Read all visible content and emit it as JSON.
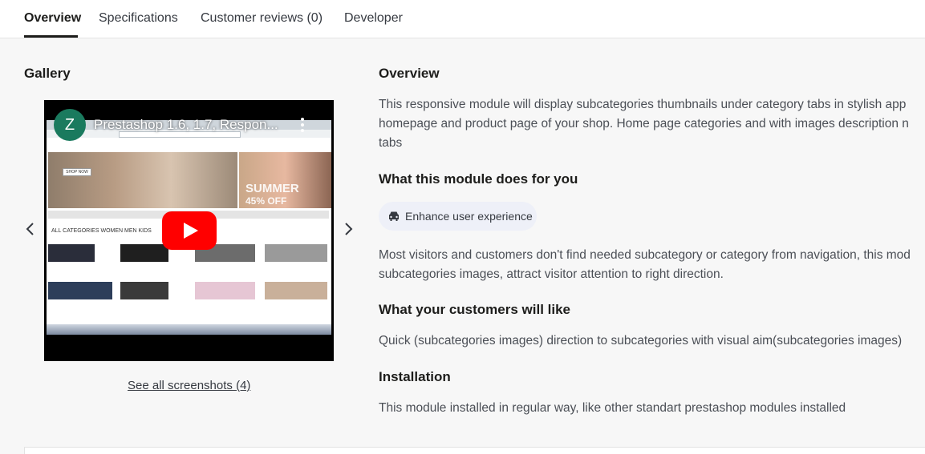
{
  "tabs": [
    {
      "label": "Overview",
      "active": true
    },
    {
      "label": "Specifications",
      "active": false
    },
    {
      "label": "Customer reviews (0)",
      "active": false
    },
    {
      "label": "Developer",
      "active": false
    }
  ],
  "gallery": {
    "title": "Gallery",
    "video": {
      "channel_initial": "Z",
      "title": "Prestashop 1.6, 1.7, Respon...",
      "banner_summer": "SUMMER",
      "banner_sale": "45% OFF",
      "categories_label": "ALL CATEGORIES   WOMEN   MEN   KIDS",
      "play_icon": "youtube-play-icon"
    },
    "see_all_label": "See all screenshots (4)"
  },
  "overview": {
    "title": "Overview",
    "description_line1": "This responsive module will display  subcategories thumbnails under category tabs in stylish app",
    "description_line2": "homepage and product page of your shop. Home page categories and with images description n",
    "description_line3": "tabs"
  },
  "module_does": {
    "title": "What this module does for you",
    "chip_label": "Enhance user experience",
    "chip_icon": "car-icon",
    "text_line1": "Most visitors and customers don't find needed subcategory or category from navigation, this mod",
    "text_line2": "subcategories images, attract visitor attention to right direction."
  },
  "customers_like": {
    "title": "What your customers will like",
    "text": "Quick (subcategories images) direction to subcategories with visual aim(subcategories images)"
  },
  "installation": {
    "title": "Installation",
    "text": "This module installed in regular way, like other standart prestashop modules installed"
  },
  "colors": {
    "chip_background": "#eef0f8",
    "youtube_red": "#ff0000",
    "channel_avatar": "#1a7a5e"
  }
}
